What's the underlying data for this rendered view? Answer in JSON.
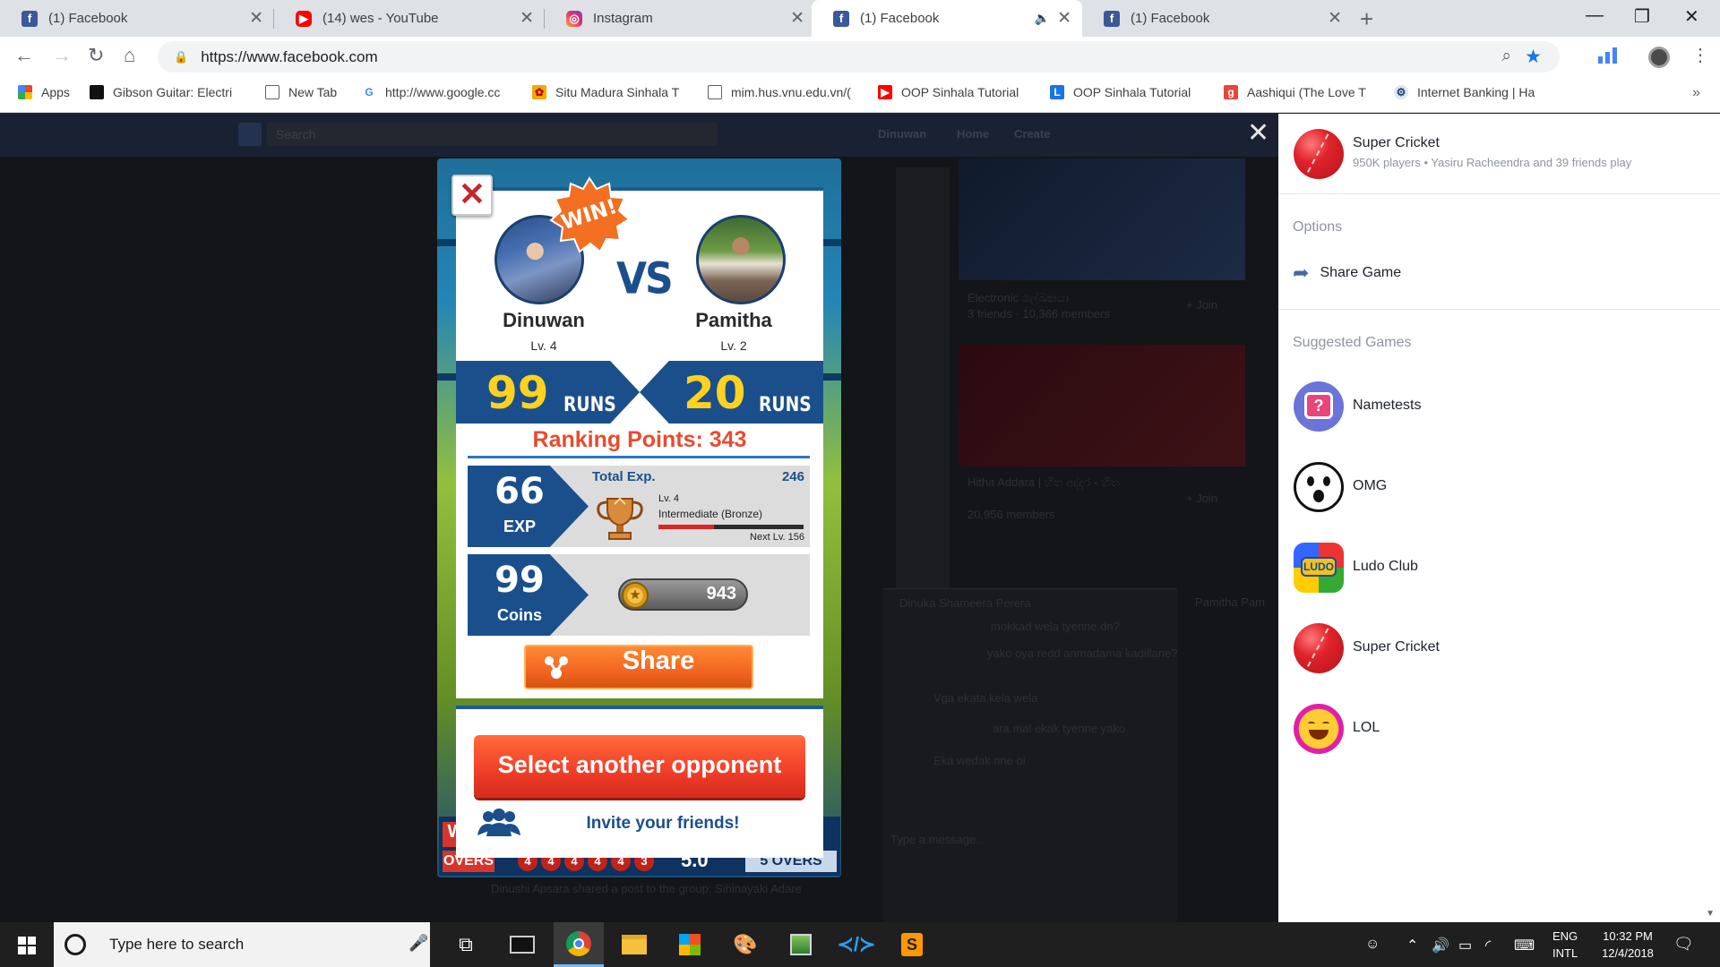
{
  "browser": {
    "tabs": [
      {
        "title": "(1) Facebook",
        "favicon": "facebook-icon",
        "active": false
      },
      {
        "title": "(14) wes - YouTube",
        "favicon": "youtube-icon",
        "active": false
      },
      {
        "title": "Instagram",
        "favicon": "instagram-icon",
        "active": false
      },
      {
        "title": "(1) Facebook",
        "favicon": "facebook-icon",
        "active": true,
        "audio": true
      },
      {
        "title": "(1) Facebook",
        "favicon": "facebook-icon",
        "active": false
      }
    ],
    "url": "https://www.facebook.com",
    "bookmarks": [
      {
        "label": "Apps",
        "icon": "apps-grid-icon"
      },
      {
        "label": "Gibson Guitar: Electri",
        "icon": "gibson-icon"
      },
      {
        "label": "New Tab",
        "icon": "page-icon"
      },
      {
        "label": "http://www.google.cc",
        "icon": "google-icon"
      },
      {
        "label": "Situ Madura Sinhala T",
        "icon": "situ-icon"
      },
      {
        "label": "mim.hus.vnu.edu.vn/(",
        "icon": "page-icon"
      },
      {
        "label": "OOP Sinhala Tutorial",
        "icon": "youtube-icon"
      },
      {
        "label": "OOP Sinhala Tutorial",
        "icon": "l-icon"
      },
      {
        "label": "Aashiqui (The Love T",
        "icon": "g-icon"
      },
      {
        "label": "Internet Banking | Ha",
        "icon": "bank-icon"
      }
    ],
    "more_bookmarks": "»"
  },
  "fb_background": {
    "search_placeholder": "Search",
    "nav": [
      "Dinuwan",
      "Home",
      "Create"
    ],
    "group1_title": "Electronic ලේඛකයා",
    "group1_meta": "3 friends · 10,366 members",
    "group2_title": "Hitha Addara | හිත අද්දර - හිත",
    "group2_meta": "20,956 members",
    "join_label": "+ Join",
    "post_line": "Dinushi Apsara shared a post to the group: Sihinayaki Adare",
    "chat_name": "Dinuka Shameera Perera",
    "chat_msgs": [
      "mokkad wela tyenne dn?",
      "yako oya redd anmadama kadillane?",
      "Vga ekata kela wela",
      "ara mal ekak tyenne yako",
      "Eka wedak nne oi"
    ],
    "chat_placeholder": "Type a message...",
    "chat2_name": "Pamitha Pam"
  },
  "game": {
    "win_badge": "WIN!",
    "vs": "VS",
    "player1": {
      "name": "Dinuwan",
      "level": "Lv. 4",
      "runs": "99"
    },
    "player2": {
      "name": "Pamitha",
      "level": "Lv. 2",
      "runs": "20"
    },
    "runs_label": "RUNS",
    "ranking_points": "Ranking Points: 343",
    "exp": {
      "value": "66",
      "label": "EXP",
      "total_label": "Total Exp.",
      "total_value": "246",
      "level": "Lv. 4",
      "rank": "Intermediate (Bronze)",
      "next_level": "Next Lv. 156",
      "progress_fraction": 0.38
    },
    "coins": {
      "value": "99",
      "label": "Coins",
      "total": "943"
    },
    "share_label": "Share",
    "select_opponent_label": "Select another opponent",
    "invite_label": "Invite your friends!",
    "overs_left": "OVERS",
    "overs_balls": [
      "4",
      "4",
      "4",
      "4",
      "4",
      "3"
    ],
    "overs_value": "5.0",
    "overs_right_num": "5",
    "overs_right": "OVERS",
    "bottom_letter": "W"
  },
  "right_panel": {
    "game_title": "Super Cricket",
    "game_sub": "950K players • Yasiru Racheendra and 39 friends play",
    "options_heading": "Options",
    "share_game": "Share Game",
    "suggested_heading": "Suggested Games",
    "suggested": [
      {
        "name": "Nametests",
        "icon": "nametests-icon"
      },
      {
        "name": "OMG",
        "icon": "omg-icon"
      },
      {
        "name": "Ludo Club",
        "icon": "ludo-club-icon"
      },
      {
        "name": "Super Cricket",
        "icon": "cricket-ball-icon"
      },
      {
        "name": "LOL",
        "icon": "lol-icon"
      }
    ]
  },
  "taskbar": {
    "search_placeholder": "Type here to search",
    "lang_line1": "ENG",
    "lang_line2": "INTL",
    "time": "10:32 PM",
    "date": "12/4/2018"
  },
  "colors": {
    "game_blue": "#1b4f8c",
    "runs_yellow": "#ffd21f",
    "ranking_red": "#e94b2f",
    "share_orange": "#f26522",
    "select_red": "#f2402a"
  }
}
